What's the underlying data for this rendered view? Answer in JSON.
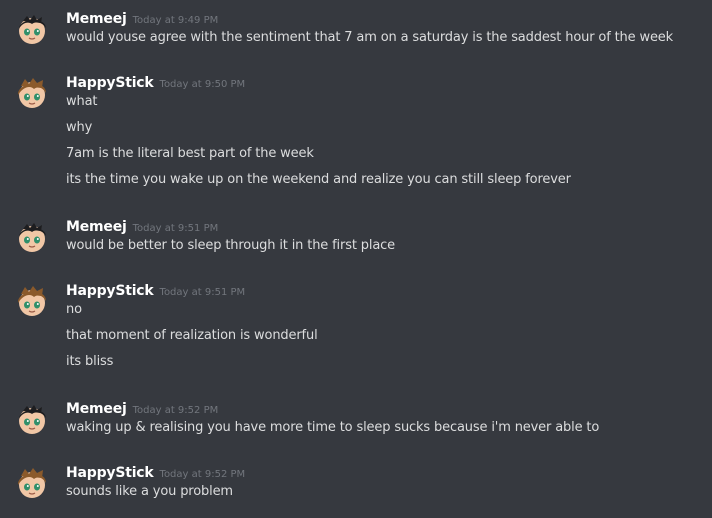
{
  "messages": [
    {
      "author": "Memeej",
      "timestamp": "Today at 9:49 PM",
      "avatar": "dark-hair-avatar-icon",
      "lines": [
        "would youse agree with the sentiment that 7 am on a saturday is the saddest hour of the week"
      ]
    },
    {
      "author": "HappyStick",
      "timestamp": "Today at 9:50 PM",
      "avatar": "brown-hair-avatar-icon",
      "lines": [
        "what",
        "why",
        "7am is the literal best part of the week",
        "its the time you wake up on the weekend and realize you can still sleep forever"
      ]
    },
    {
      "author": "Memeej",
      "timestamp": "Today at 9:51 PM",
      "avatar": "dark-hair-avatar-icon",
      "lines": [
        "would be better to sleep through it in the first place"
      ]
    },
    {
      "author": "HappyStick",
      "timestamp": "Today at 9:51 PM",
      "avatar": "brown-hair-avatar-icon",
      "lines": [
        "no",
        "that moment of realization is wonderful",
        "its bliss"
      ]
    },
    {
      "author": "Memeej",
      "timestamp": "Today at 9:52 PM",
      "avatar": "dark-hair-avatar-icon",
      "lines": [
        "waking up & realising you have more time to sleep sucks because i'm never able to"
      ]
    },
    {
      "author": "HappyStick",
      "timestamp": "Today at 9:52 PM",
      "avatar": "brown-hair-avatar-icon",
      "lines": [
        "sounds like a you problem"
      ]
    }
  ]
}
